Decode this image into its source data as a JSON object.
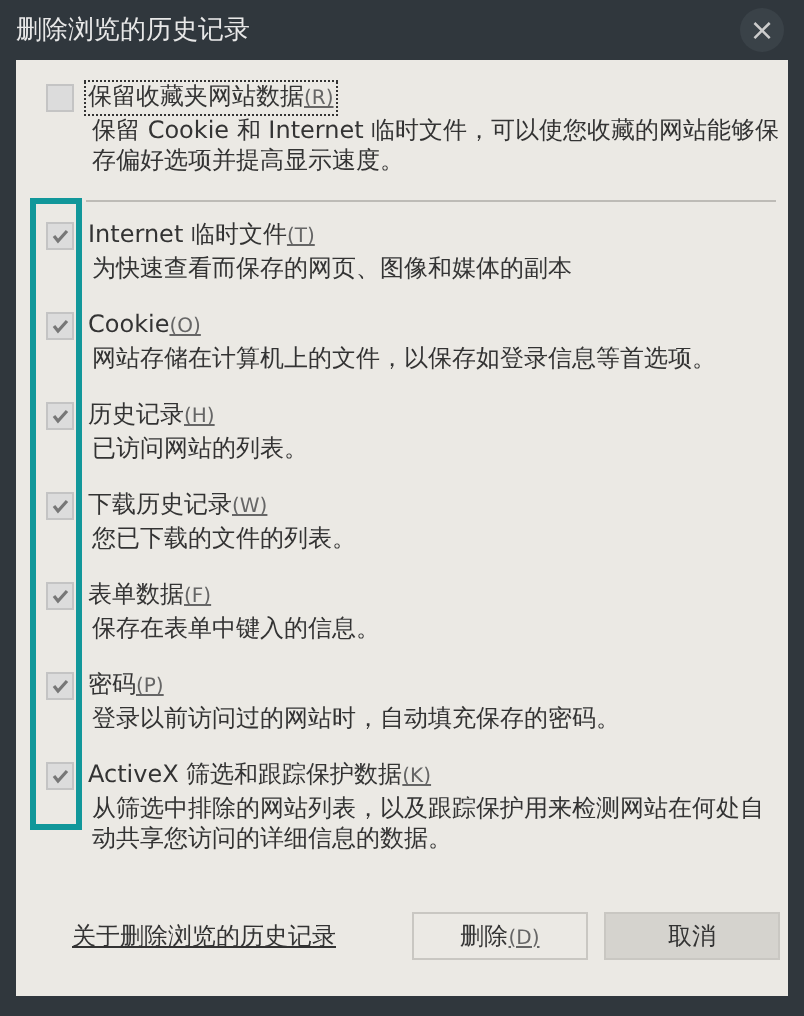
{
  "window": {
    "title": "删除浏览的历史记录",
    "close": "×"
  },
  "options": [
    {
      "label": "保留收藏夹网站数据",
      "shortcut": "(R)",
      "description": "保留 Cookie 和 Internet 临时文件，可以使您收藏的网站能够保存偏好选项并提高显示速度。",
      "checked": false,
      "focused": true
    },
    {
      "label": "Internet 临时文件",
      "shortcut": "(T)",
      "description": "为快速查看而保存的网页、图像和媒体的副本",
      "checked": true,
      "focused": false
    },
    {
      "label": "Cookie",
      "shortcut": "(O)",
      "description": "网站存储在计算机上的文件，以保存如登录信息等首选项。",
      "checked": true,
      "focused": false
    },
    {
      "label": "历史记录",
      "shortcut": "(H)",
      "description": "已访问网站的列表。",
      "checked": true,
      "focused": false
    },
    {
      "label": "下载历史记录",
      "shortcut": "(W)",
      "description": "您已下载的文件的列表。",
      "checked": true,
      "focused": false
    },
    {
      "label": "表单数据",
      "shortcut": "(F)",
      "description": "保存在表单中键入的信息。",
      "checked": true,
      "focused": false
    },
    {
      "label": "密码",
      "shortcut": "(P)",
      "description": "登录以前访问过的网站时，自动填充保存的密码。",
      "checked": true,
      "focused": false
    },
    {
      "label": "ActiveX 筛选和跟踪保护数据",
      "shortcut": "(K)",
      "description": "从筛选中排除的网站列表，以及跟踪保护用来检测网站在何处自动共享您访问的详细信息的数据。",
      "checked": true,
      "focused": false
    }
  ],
  "footer": {
    "link": "关于删除浏览的历史记录",
    "buttons": [
      {
        "label": "删除",
        "shortcut": "(D)",
        "hovered": false
      },
      {
        "label": "取消",
        "hovered": true
      }
    ]
  }
}
